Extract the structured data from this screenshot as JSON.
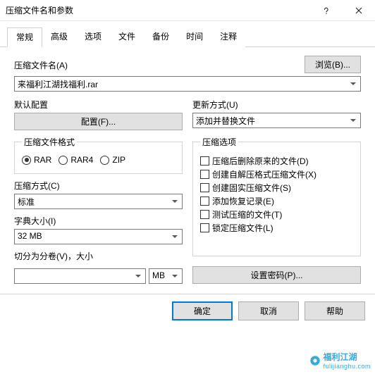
{
  "window": {
    "title": "压缩文件名和参数"
  },
  "tabs": [
    "常规",
    "高级",
    "选项",
    "文件",
    "备份",
    "时间",
    "注释"
  ],
  "filename": {
    "label": "压缩文件名(A)",
    "value": "来福利江湖找福利.rar"
  },
  "browse_btn": "浏览(B)...",
  "profile": {
    "label": "默认配置",
    "button": "配置(F)..."
  },
  "update": {
    "label": "更新方式(U)",
    "value": "添加并替换文件"
  },
  "format": {
    "legend": "压缩文件格式",
    "options": [
      "RAR",
      "RAR4",
      "ZIP"
    ],
    "selected": "RAR"
  },
  "method": {
    "label": "压缩方式(C)",
    "value": "标准"
  },
  "dict": {
    "label": "字典大小(I)",
    "value": "32 MB"
  },
  "split": {
    "label": "切分为分卷(V)，大小",
    "value": "",
    "unit": "MB"
  },
  "options": {
    "legend": "压缩选项",
    "items": [
      "压缩后删除原来的文件(D)",
      "创建自解压格式压缩文件(X)",
      "创建固实压缩文件(S)",
      "添加恢复记录(E)",
      "测试压缩的文件(T)",
      "锁定压缩文件(L)"
    ]
  },
  "password_btn": "设置密码(P)...",
  "footer": {
    "ok": "确定",
    "cancel": "取消",
    "help": "帮助"
  },
  "watermark": {
    "cn": "福利江湖",
    "en": "fulijianghu.com"
  }
}
